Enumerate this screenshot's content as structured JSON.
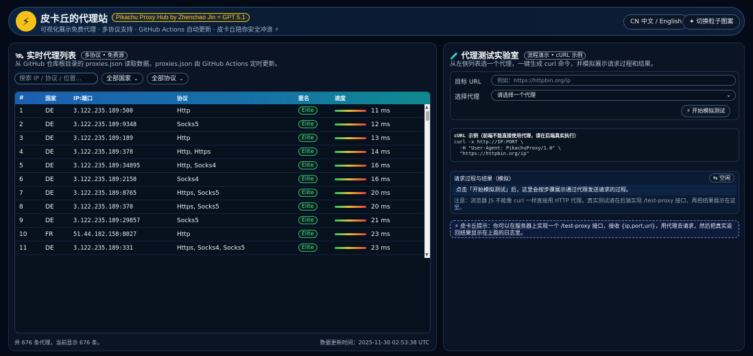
{
  "header": {
    "logo_glyph": "⚡",
    "title": "皮卡丘的代理站",
    "badge": "Pikachu Proxy Hub by Zhenchao Jin + GPT 5.1",
    "subtitle": "可视化展示免费代理 · 多协议支持 · GitHub Actions 自动更新 · 皮卡丘陪你安全冲浪 ⚡",
    "lang_button": "CN 中文 / English",
    "particle_button": "✦ 切换粒子图案"
  },
  "proxy_list": {
    "title": "实时代理列表",
    "icon": "🛰",
    "tag": "多协议 • 免费源",
    "description": "从 GitHub 仓库根目录的 proxies.json 读取数据。proxies.json 由 GitHub Actions 定时更新。",
    "search_placeholder": "搜索 IP / 协议 / 位置...",
    "country_filter": "全部国家",
    "protocol_filter": "全部协议",
    "columns": [
      "#",
      "国家",
      "IP:端口",
      "协议",
      "匿名",
      "速度"
    ],
    "rows": [
      {
        "idx": "1",
        "country": "DE",
        "addr": "3.122.235.189:500",
        "protocol": "Http",
        "anon": "Elite",
        "speed": "11 ms",
        "speed_ms": 11
      },
      {
        "idx": "2",
        "country": "DE",
        "addr": "3.122.235.189:9348",
        "protocol": "Socks5",
        "anon": "Elite",
        "speed": "12 ms",
        "speed_ms": 12
      },
      {
        "idx": "3",
        "country": "DE",
        "addr": "3.122.235.189:189",
        "protocol": "Http",
        "anon": "Elite",
        "speed": "13 ms",
        "speed_ms": 13
      },
      {
        "idx": "4",
        "country": "DE",
        "addr": "3.122.235.189:378",
        "protocol": "Http, Https",
        "anon": "Elite",
        "speed": "14 ms",
        "speed_ms": 14
      },
      {
        "idx": "5",
        "country": "DE",
        "addr": "3.122.235.189:34895",
        "protocol": "Http, Socks4",
        "anon": "Elite",
        "speed": "16 ms",
        "speed_ms": 16
      },
      {
        "idx": "6",
        "country": "DE",
        "addr": "3.122.235.189:2158",
        "protocol": "Socks4",
        "anon": "Elite",
        "speed": "16 ms",
        "speed_ms": 16
      },
      {
        "idx": "7",
        "country": "DE",
        "addr": "3.122.235.189:8765",
        "protocol": "Https, Socks5",
        "anon": "Elite",
        "speed": "20 ms",
        "speed_ms": 20
      },
      {
        "idx": "8",
        "country": "DE",
        "addr": "3.122.235.189:370",
        "protocol": "Https, Socks5",
        "anon": "Elite",
        "speed": "20 ms",
        "speed_ms": 20
      },
      {
        "idx": "9",
        "country": "DE",
        "addr": "3.122.235.189:29857",
        "protocol": "Socks5",
        "anon": "Elite",
        "speed": "21 ms",
        "speed_ms": 21
      },
      {
        "idx": "10",
        "country": "FR",
        "addr": "51.44.182.158:8027",
        "protocol": "Http",
        "anon": "Elite",
        "speed": "23 ms",
        "speed_ms": 23
      },
      {
        "idx": "11",
        "country": "DE",
        "addr": "3.122.235.189:331",
        "protocol": "Https, Socks4, Socks5",
        "anon": "Elite",
        "speed": "23 ms",
        "speed_ms": 23
      }
    ],
    "footer_count": "共 676 条代理，当前显示 676 条。",
    "footer_updated": "数据更新时间：2025-11-30 02:53:38 UTC"
  },
  "lab": {
    "title": "代理测试实验室",
    "icon": "🧪",
    "tag": "流程演示 • cURL 示例",
    "description": "从左侧列表选一个代理，一键生成 curl 命令，并模拟展示请求过程和结果。",
    "url_label": "目标 URL",
    "url_placeholder": "例如：https://httpbin.org/ip",
    "proxy_label": "选择代理",
    "proxy_select": "请选择一个代理",
    "test_button": "⚡ 开始模拟测试",
    "curl_title": "cURL 示例（前端不能直接使用代理，请在后端真实执行）",
    "curl_code": "curl -x http://IP:PORT \\\n  -H \"User-Agent: PikachuProxy/1.0\" \\\n  \"https://httpbin.org/ip\"",
    "result_title": "请求过程与结果（模拟）",
    "clear_button": "⇆ 空闲",
    "result_message": "点击「开始模拟测试」后，这里会按步骤展示通过代理发送请求的过程。",
    "result_note": "注意：浏览器 JS 不能像 curl 一样直接用 HTTP 代理。真实测试请在后端实现 /test-proxy 接口，再把结果展示在这里。",
    "tip": "⚡ 皮卡丘提示：你可以在服务器上实现一个 /test-proxy 接口，接收 {ip,port,url}，用代理去请求，然后把真实返回结果显示在上面的日志里。"
  },
  "colors": {
    "accent": "#f6c21a",
    "elite": "#54e08f",
    "header_gradient_start": "#1b5fb0",
    "header_gradient_end": "#0f8a8e"
  }
}
